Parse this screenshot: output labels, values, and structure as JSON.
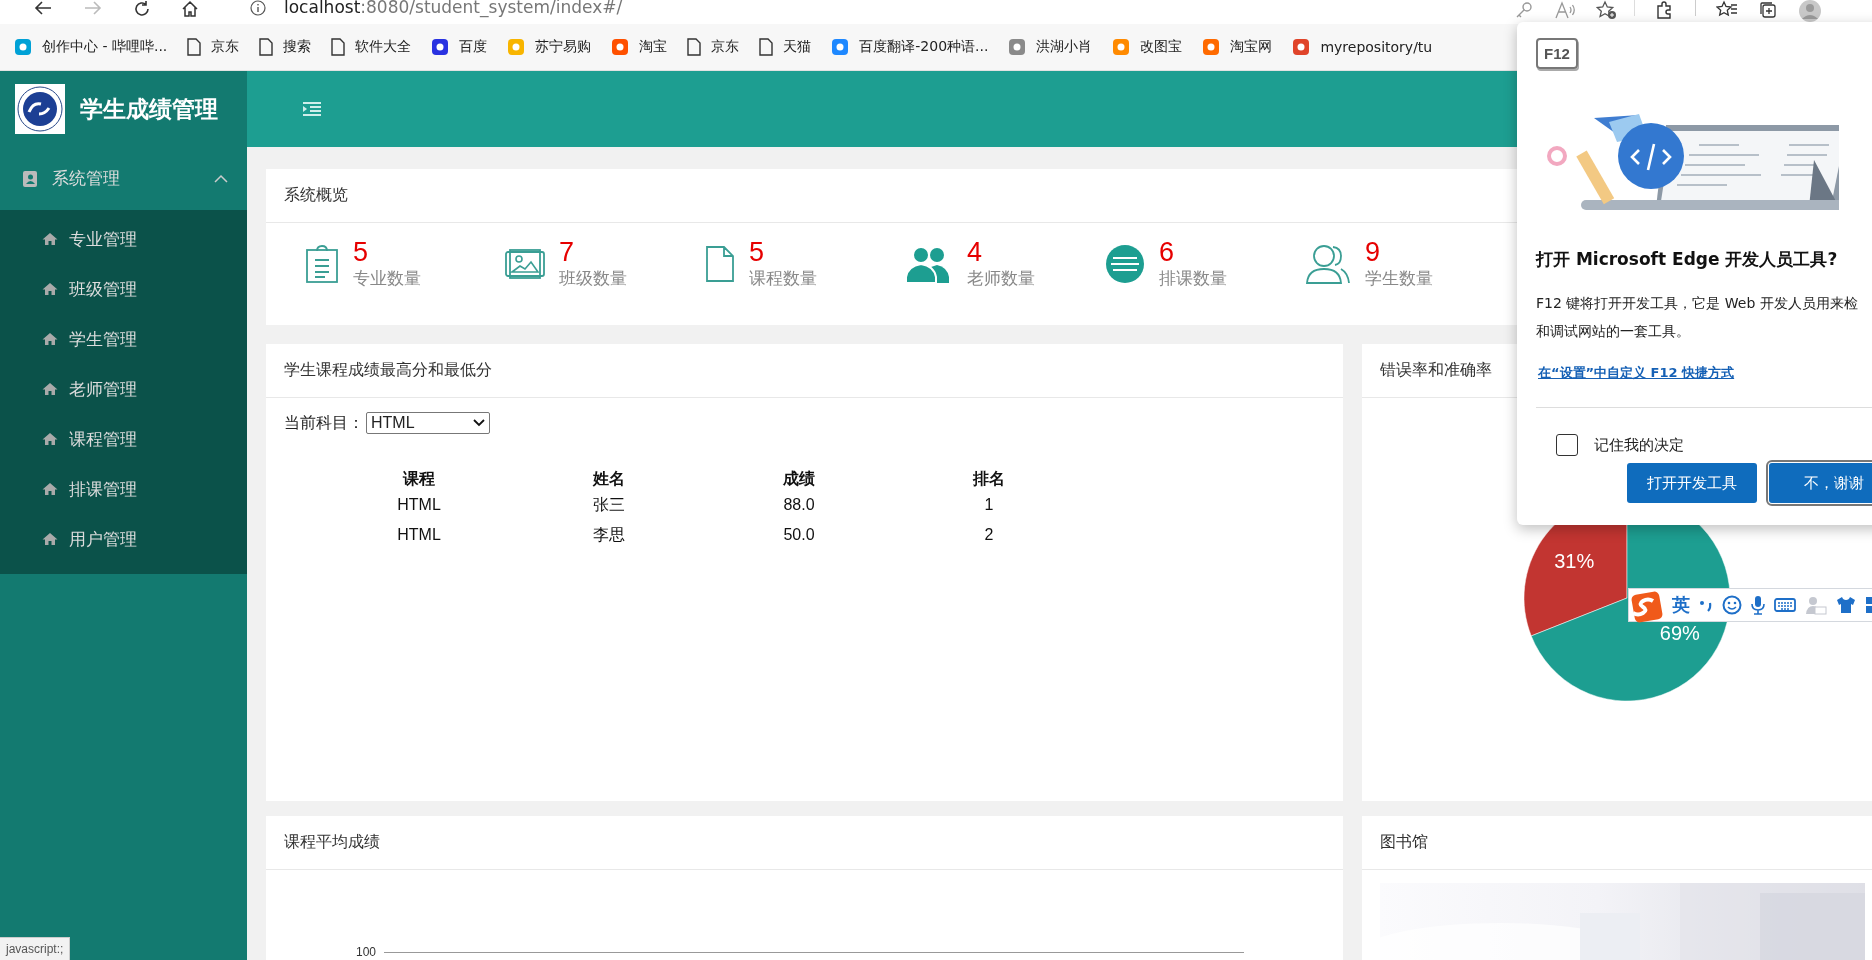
{
  "browser": {
    "address": {
      "host": "localhost",
      "path": ":8080/student_system/index#/"
    },
    "bookmarks": [
      {
        "label": "创作中心 - 哔哩哔...",
        "kind": "site",
        "color": "#00a1d6"
      },
      {
        "label": "京东",
        "kind": "page"
      },
      {
        "label": "搜索",
        "kind": "page"
      },
      {
        "label": "软件大全",
        "kind": "page"
      },
      {
        "label": "百度",
        "kind": "site",
        "color": "#2932e1"
      },
      {
        "label": "苏宁易购",
        "kind": "site",
        "color": "#f8b500"
      },
      {
        "label": "淘宝",
        "kind": "site",
        "color": "#ff5000"
      },
      {
        "label": "京东",
        "kind": "page"
      },
      {
        "label": "天猫",
        "kind": "page"
      },
      {
        "label": "百度翻译-200种语...",
        "kind": "site",
        "color": "#1e88ff"
      },
      {
        "label": "洪湖小肖",
        "kind": "site",
        "color": "#8a8a8a"
      },
      {
        "label": "改图宝",
        "kind": "site",
        "color": "#ff8a00"
      },
      {
        "label": "淘宝网",
        "kind": "site",
        "color": "#ff6a00"
      },
      {
        "label": "myrepository/tu",
        "kind": "site",
        "color": "#e0442a"
      }
    ],
    "status_text": "javascript:;"
  },
  "app": {
    "title": "学生成绩管理",
    "sidebar": {
      "group": {
        "label": "系统管理",
        "expanded": true
      },
      "items": [
        {
          "label": "专业管理"
        },
        {
          "label": "班级管理"
        },
        {
          "label": "学生管理"
        },
        {
          "label": "老师管理"
        },
        {
          "label": "课程管理"
        },
        {
          "label": "排课管理"
        },
        {
          "label": "用户管理"
        }
      ]
    },
    "overview": {
      "title": "系统概览",
      "stats": [
        {
          "kind": "clipboard",
          "value": "5",
          "label": "专业数量"
        },
        {
          "kind": "picture",
          "value": "7",
          "label": "班级数量"
        },
        {
          "kind": "document",
          "value": "5",
          "label": "课程数量"
        },
        {
          "kind": "people-filled",
          "value": "4",
          "label": "老师数量"
        },
        {
          "kind": "list-circle",
          "value": "6",
          "label": "排课数量"
        },
        {
          "kind": "people-outline",
          "value": "9",
          "label": "学生数量"
        }
      ]
    },
    "scores": {
      "title": "学生课程成绩最高分和最低分",
      "subject_label": "当前科目：",
      "subject": "HTML",
      "columns": [
        "课程",
        "姓名",
        "成绩",
        "排名"
      ],
      "rows": [
        [
          "HTML",
          "张三",
          "88.0",
          "1"
        ],
        [
          "HTML",
          "李思",
          "50.0",
          "2"
        ]
      ]
    },
    "ratio": {
      "title": "错误率和准确率",
      "chart_data": {
        "type": "pie",
        "values": [
          31,
          69
        ],
        "colors": [
          "#c23531",
          "#1d9e91"
        ],
        "value_labels": [
          "31%",
          "69%"
        ]
      }
    },
    "average": {
      "title": "课程平均成绩",
      "axis_label": "100"
    },
    "library": {
      "title": "图书馆",
      "kind": "picture"
    }
  },
  "dialog": {
    "key": "F12",
    "title": "打开 Microsoft Edge 开发人员工具?",
    "description_lines": [
      "F12 键将打开开发工具，它是 Web 开发人员用来检",
      "和调试网站的一套工具。"
    ],
    "link": "在“设置”中自定义 F12 快捷方式",
    "remember": {
      "label": "记住我的决定",
      "checked": false
    },
    "buttons": [
      {
        "label": "打开开发工具",
        "kind": "primary"
      },
      {
        "label": "不，谢谢",
        "kind": "focused"
      }
    ]
  },
  "ime": {
    "mode": "英"
  }
}
